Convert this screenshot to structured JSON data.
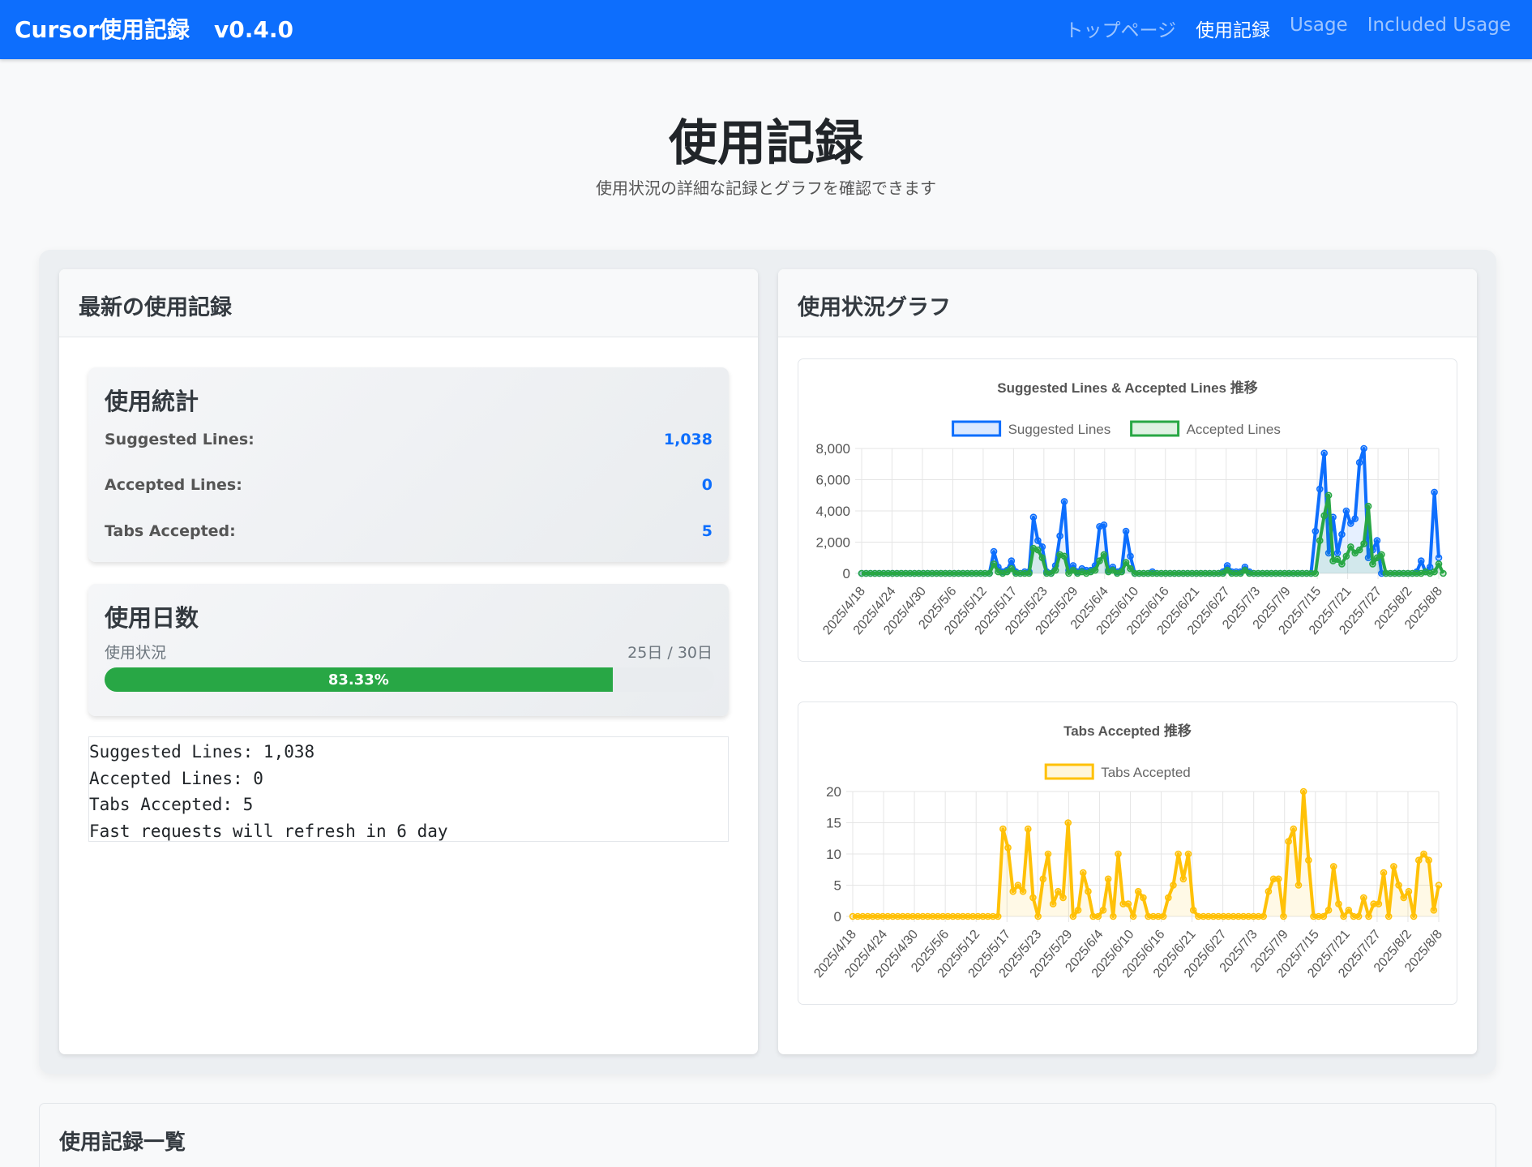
{
  "navbar": {
    "brand": "Cursor使用記録",
    "version": "v0.4.0",
    "links": [
      "トップページ",
      "使用記録",
      "Usage",
      "Included Usage"
    ]
  },
  "hero": {
    "title": "使用記録",
    "subtitle": "使用状況の詳細な記録とグラフを確認できます"
  },
  "left_card": {
    "header": "最新の使用記録",
    "stats": {
      "title": "使用統計",
      "rows": [
        {
          "label": "Suggested Lines:",
          "value": "1,038"
        },
        {
          "label": "Accepted Lines:",
          "value": "0"
        },
        {
          "label": "Tabs Accepted:",
          "value": "5"
        }
      ]
    },
    "days": {
      "title": "使用日数",
      "label": "使用状況",
      "count": "25日 / 30日",
      "percent_label": "83.33%",
      "fraction": 0.8333
    },
    "raw_lines": [
      "Suggested Lines: 1,038",
      "Accepted Lines: 0",
      "Tabs Accepted: 5",
      "Fast requests will refresh in 6 day"
    ]
  },
  "right_card": {
    "header": "使用状況グラフ"
  },
  "colors": {
    "primary": "#0d6efd",
    "success": "#28a745",
    "warning": "#ffc107"
  },
  "chart_data": [
    {
      "type": "line",
      "title": "Suggested Lines & Accepted Lines 推移",
      "legend_position": "top",
      "grid": true,
      "ylim": [
        0,
        8000
      ],
      "yticks": [
        "0",
        "2,000",
        "4,000",
        "6,000",
        "8,000"
      ],
      "xticks": [
        "2025/4/18",
        "2025/4/24",
        "2025/4/30",
        "2025/5/6",
        "2025/5/12",
        "2025/5/17",
        "2025/5/23",
        "2025/5/29",
        "2025/6/4",
        "2025/6/10",
        "2025/6/16",
        "2025/6/21",
        "2025/6/27",
        "2025/7/3",
        "2025/7/9",
        "2025/7/15",
        "2025/7/21",
        "2025/7/27",
        "2025/8/2",
        "2025/8/8"
      ],
      "series": [
        {
          "name": "Suggested Lines",
          "color": "#0d6efd",
          "values": [
            0,
            0,
            0,
            0,
            0,
            0,
            0,
            0,
            0,
            0,
            0,
            0,
            0,
            0,
            0,
            0,
            0,
            0,
            0,
            0,
            0,
            0,
            0,
            0,
            0,
            0,
            0,
            0,
            0,
            0,
            1400,
            400,
            100,
            200,
            800,
            100,
            0,
            100,
            100,
            3600,
            2100,
            1700,
            100,
            0,
            500,
            2400,
            4600,
            200,
            500,
            100,
            300,
            200,
            200,
            500,
            3000,
            3100,
            200,
            400,
            100,
            200,
            2700,
            1100,
            0,
            0,
            0,
            0,
            100,
            0,
            0,
            0,
            0,
            0,
            0,
            0,
            0,
            0,
            0,
            0,
            0,
            0,
            0,
            0,
            100,
            500,
            100,
            100,
            100,
            400,
            100,
            0,
            0,
            0,
            0,
            0,
            0,
            0,
            0,
            0,
            0,
            0,
            0,
            0,
            0,
            2700,
            5400,
            7700,
            1300,
            3600,
            1300,
            2500,
            4000,
            3200,
            3500,
            7100,
            8000,
            1000,
            1500,
            2100,
            0,
            0,
            0,
            0,
            0,
            0,
            0,
            0,
            100,
            800,
            100,
            400,
            5200,
            1000
          ]
        },
        {
          "name": "Accepted Lines",
          "color": "#28a745",
          "values": [
            0,
            0,
            0,
            0,
            0,
            0,
            0,
            0,
            0,
            0,
            0,
            0,
            0,
            0,
            0,
            0,
            0,
            0,
            0,
            0,
            0,
            0,
            0,
            0,
            0,
            0,
            0,
            0,
            0,
            0,
            600,
            100,
            0,
            100,
            300,
            0,
            0,
            0,
            0,
            1600,
            1500,
            1000,
            0,
            0,
            200,
            1200,
            1100,
            0,
            200,
            0,
            100,
            0,
            100,
            200,
            800,
            1200,
            100,
            200,
            0,
            100,
            700,
            300,
            0,
            0,
            0,
            0,
            0,
            0,
            0,
            0,
            0,
            0,
            0,
            0,
            0,
            0,
            0,
            0,
            0,
            0,
            0,
            0,
            0,
            200,
            0,
            0,
            0,
            200,
            0,
            0,
            0,
            0,
            0,
            0,
            0,
            0,
            0,
            0,
            0,
            0,
            0,
            0,
            0,
            0,
            2100,
            3700,
            5000,
            800,
            900,
            600,
            1100,
            1700,
            1300,
            1500,
            1900,
            4300,
            600,
            1000,
            1200,
            0,
            0,
            0,
            0,
            0,
            0,
            0,
            0,
            0,
            100,
            0,
            100,
            600,
            0
          ]
        }
      ]
    },
    {
      "type": "line",
      "title": "Tabs Accepted 推移",
      "legend_position": "top",
      "grid": true,
      "ylim": [
        0,
        20
      ],
      "yticks": [
        "0",
        "5",
        "10",
        "15",
        "20"
      ],
      "xticks": [
        "2025/4/18",
        "2025/4/24",
        "2025/4/30",
        "2025/5/6",
        "2025/5/12",
        "2025/5/17",
        "2025/5/23",
        "2025/5/29",
        "2025/6/4",
        "2025/6/10",
        "2025/6/16",
        "2025/6/21",
        "2025/6/27",
        "2025/7/3",
        "2025/7/9",
        "2025/7/15",
        "2025/7/21",
        "2025/7/27",
        "2025/8/2",
        "2025/8/8"
      ],
      "series": [
        {
          "name": "Tabs Accepted",
          "color": "#ffc107",
          "values": [
            0,
            0,
            0,
            0,
            0,
            0,
            0,
            0,
            0,
            0,
            0,
            0,
            0,
            0,
            0,
            0,
            0,
            0,
            0,
            0,
            0,
            0,
            0,
            0,
            0,
            0,
            0,
            0,
            0,
            0,
            14,
            11,
            4,
            5,
            4,
            14,
            3,
            0,
            6,
            10,
            2,
            4,
            3,
            15,
            0,
            1,
            7,
            4,
            0,
            0,
            1,
            6,
            0,
            10,
            2,
            2,
            0,
            4,
            3,
            0,
            0,
            0,
            0,
            3,
            5,
            10,
            6,
            10,
            1,
            0,
            0,
            0,
            0,
            0,
            0,
            0,
            0,
            0,
            0,
            0,
            0,
            0,
            0,
            4,
            6,
            6,
            0,
            12,
            14,
            5,
            20,
            9,
            0,
            0,
            0,
            1,
            8,
            2,
            0,
            1,
            0,
            0,
            3,
            0,
            2,
            2,
            7,
            0,
            8,
            5,
            3,
            4,
            0,
            9,
            10,
            9,
            1,
            5
          ]
        }
      ]
    }
  ]
}
